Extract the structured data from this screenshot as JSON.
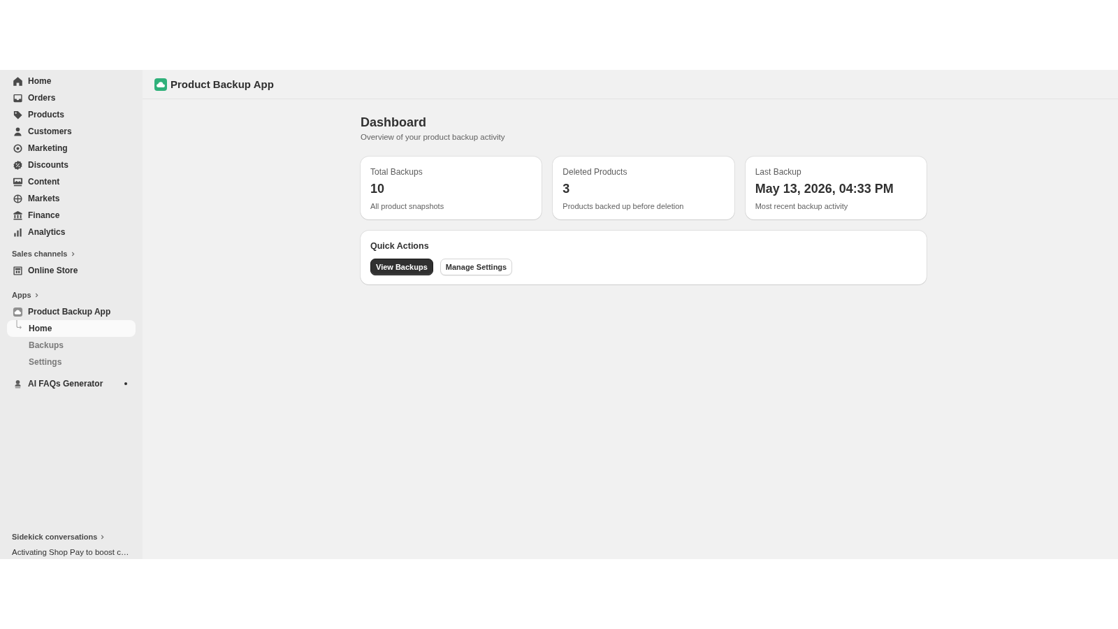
{
  "sidebar": {
    "nav_items": [
      {
        "label": "Home",
        "selected": false
      },
      {
        "label": "Orders",
        "selected": false
      },
      {
        "label": "Products",
        "selected": false
      },
      {
        "label": "Customers",
        "selected": false
      },
      {
        "label": "Marketing",
        "selected": false
      },
      {
        "label": "Discounts",
        "selected": false
      },
      {
        "label": "Content",
        "selected": false
      },
      {
        "label": "Markets",
        "selected": false
      },
      {
        "label": "Finance",
        "selected": false
      },
      {
        "label": "Analytics",
        "selected": false
      }
    ],
    "sales_channels": {
      "title": "Sales channels",
      "items": [
        {
          "label": "Online Store",
          "selected": false
        }
      ]
    },
    "apps": {
      "title": "Apps",
      "items": [
        {
          "label": "Product Backup App",
          "selected": false,
          "badge_dot": false,
          "children": [
            {
              "label": "Home",
              "selected": true
            },
            {
              "label": "Backups",
              "selected": false
            },
            {
              "label": "Settings",
              "selected": false
            }
          ]
        },
        {
          "label": "AI FAQs Generator",
          "selected": false,
          "badge_dot": true
        }
      ]
    },
    "sidekick": {
      "title": "Sidekick conversations",
      "items": [
        {
          "label": "Activating Shop Pay to boost c…",
          "selected": false
        }
      ]
    }
  },
  "header": {
    "title": "Product Backup App"
  },
  "dashboard": {
    "title": "Dashboard",
    "subtitle": "Overview of your product backup activity",
    "stats": [
      {
        "label": "Total Backups",
        "value": "10",
        "description": "All product snapshots"
      },
      {
        "label": "Deleted Products",
        "value": "3",
        "description": "Products backed up before deletion"
      },
      {
        "label": "Last Backup",
        "value": "May 13, 2026, 04:33 PM",
        "description": "Most recent backup activity"
      }
    ],
    "quick_actions": {
      "title": "Quick Actions",
      "buttons": [
        {
          "label": "View Backups",
          "kind": "primary"
        },
        {
          "label": "Manage Settings",
          "kind": "secondary"
        }
      ]
    }
  }
}
